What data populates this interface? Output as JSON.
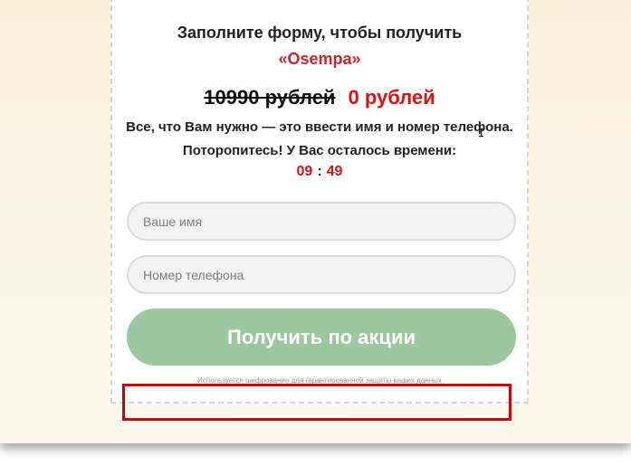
{
  "form": {
    "title": "Заполните форму, чтобы получить",
    "product": "«Osempa»",
    "old_price": "10990 рублей",
    "new_price": "0 рублей",
    "description": "Все, что Вам нужно — это ввести имя и номер телефона.",
    "hurry_text": "Поторопитесь! У Вас осталось времени:",
    "timer": {
      "minutes": "09",
      "separator": ":",
      "seconds": "49"
    },
    "name_placeholder": "Ваше имя",
    "phone_placeholder": "Номер телефона",
    "submit_label": "Получить по акции",
    "security_note": "Используется шифрование для гарантированной защиты ваших данных"
  },
  "colors": {
    "accent_red": "#e01010",
    "product_red": "#c62828",
    "button_green": "#9cc79f",
    "highlight_red": "#d40000"
  },
  "icons": {
    "cursor": "text-cursor-icon"
  }
}
